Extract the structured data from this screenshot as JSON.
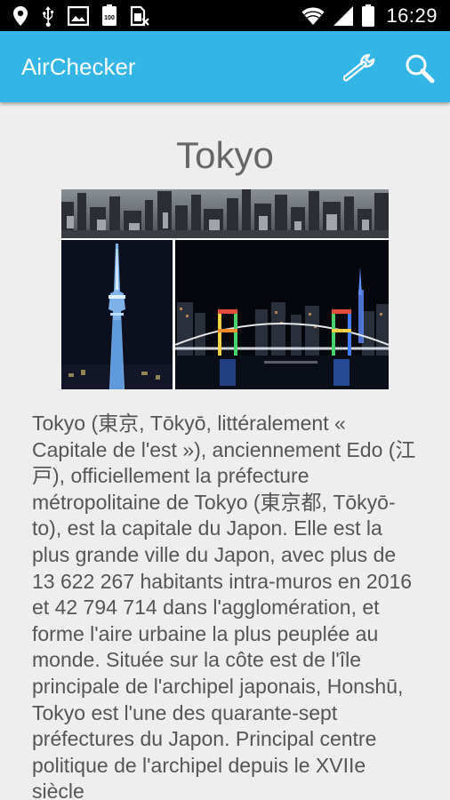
{
  "status_bar": {
    "time": "16:29",
    "left_icons": [
      "location-pin-icon",
      "usb-icon",
      "image-icon",
      "battery-100-icon",
      "sim-off-icon"
    ],
    "right_icons": [
      "wifi-icon",
      "signal-icon",
      "battery-icon"
    ]
  },
  "app_bar": {
    "title": "AirChecker",
    "actions": [
      "wrench-icon",
      "search-icon"
    ],
    "color": "#33b5e5"
  },
  "city": {
    "name": "Tokyo",
    "description": "Tokyo (東京, Tōkyō, littéralement « Capitale de l'est »), anciennement Edo (江戸), officiellement la préfecture métropolitaine de Tokyo (東京都, Tōkyō-to), est la capitale du Japon. Elle est la plus grande ville du Japon, avec plus de 13 622 267 habitants intra-muros en 2016 et 42 794 714 dans l'agglomération, et forme l'aire urbaine la plus peuplée au monde. Située sur la côte est de l'île principale de l'archipel japonais, Honshū, Tokyo est l'une des quarante-sept préfectures du Japon. Principal centre politique de l'archipel depuis le XVIIe siècle"
  }
}
